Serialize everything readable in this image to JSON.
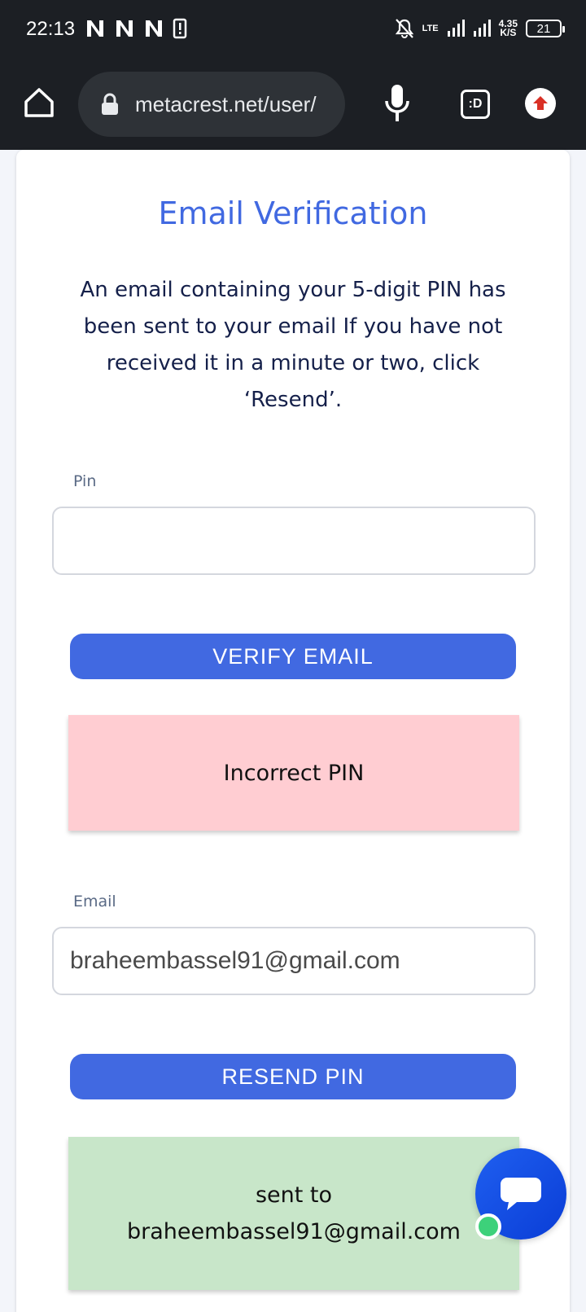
{
  "status_bar": {
    "time": "22:13",
    "network_speed_value": "4.35",
    "network_speed_unit": "K/S",
    "network_type": "LTE",
    "battery": "21"
  },
  "browser": {
    "url": "metacrest.net/user/",
    "tabs_label": ":D"
  },
  "page": {
    "title": "Email Verification",
    "description": "An email containing your 5-digit PIN has been sent to your email If you have not received it in a minute or two, click ‘Resend’.",
    "pin_label": "Pin",
    "pin_value": "",
    "verify_button": "VERIFY EMAIL",
    "error_message": "Incorrect PIN",
    "email_label": "Email",
    "email_value": "braheembassel91@gmail.com",
    "resend_button": "RESEND PIN",
    "success_line1": "sent to",
    "success_line2": "braheembassel91@gmail.com"
  },
  "colors": {
    "accent": "#4169e1",
    "error_bg": "#ffcdd2",
    "success_bg": "#c8e6c9",
    "status_dot": "#3dd17a"
  },
  "icons": [
    "n-notification-icon",
    "sim-alert-icon",
    "bell-off-icon",
    "signal-icon",
    "home-icon",
    "lock-icon",
    "mic-icon",
    "update-icon",
    "chat-bubble-icon"
  ]
}
